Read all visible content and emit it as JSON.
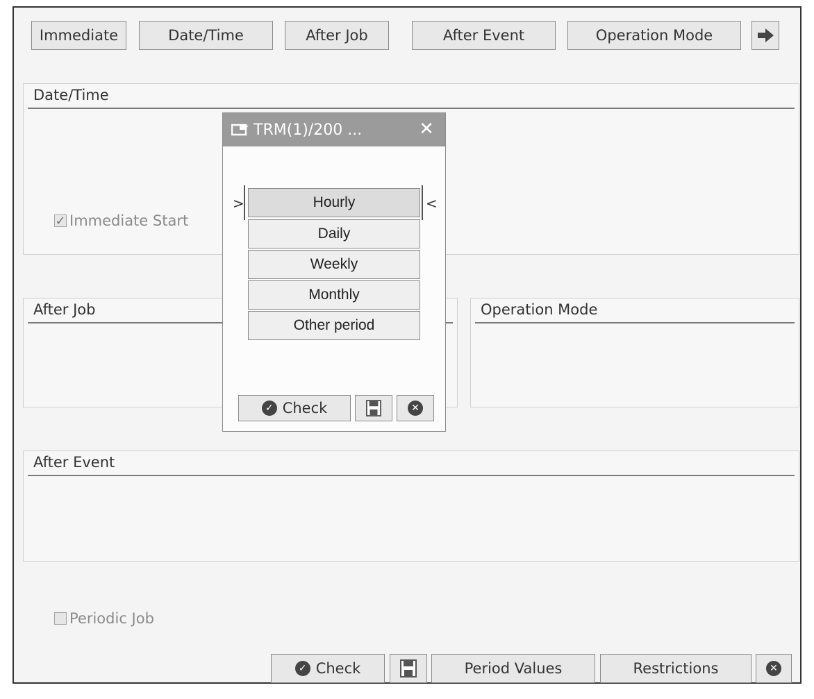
{
  "toolbar": {
    "immediate": "Immediate",
    "date_time": "Date/Time",
    "after_job": "After Job",
    "after_event": "After Event",
    "operation_mode": "Operation Mode",
    "next_icon": "arrow-right-icon"
  },
  "sections": {
    "date_time": "Date/Time",
    "after_job": "After Job",
    "operation_mode": "Operation Mode",
    "after_event": "After Event"
  },
  "checkboxes": {
    "immediate_start": {
      "label": "Immediate Start",
      "checked": true
    },
    "periodic_job": {
      "label": "Periodic Job",
      "checked": false
    }
  },
  "dialog": {
    "title": "TRM(1)/200 ...",
    "title_icon": "window-icon",
    "close_icon": "close-icon",
    "selected_left_marker": ">",
    "selected_right_marker": "<",
    "options": [
      "Hourly",
      "Daily",
      "Weekly",
      "Monthly",
      "Other period"
    ],
    "selected": "Hourly",
    "check_label": "Check",
    "check_icon": "check-circle-icon",
    "save_icon": "save-icon",
    "cancel_icon": "cancel-icon"
  },
  "footer": {
    "check_label": "Check",
    "check_icon": "check-circle-icon",
    "save_icon": "save-icon",
    "period_values": "Period Values",
    "restrictions": "Restrictions",
    "cancel_icon": "cancel-icon"
  }
}
